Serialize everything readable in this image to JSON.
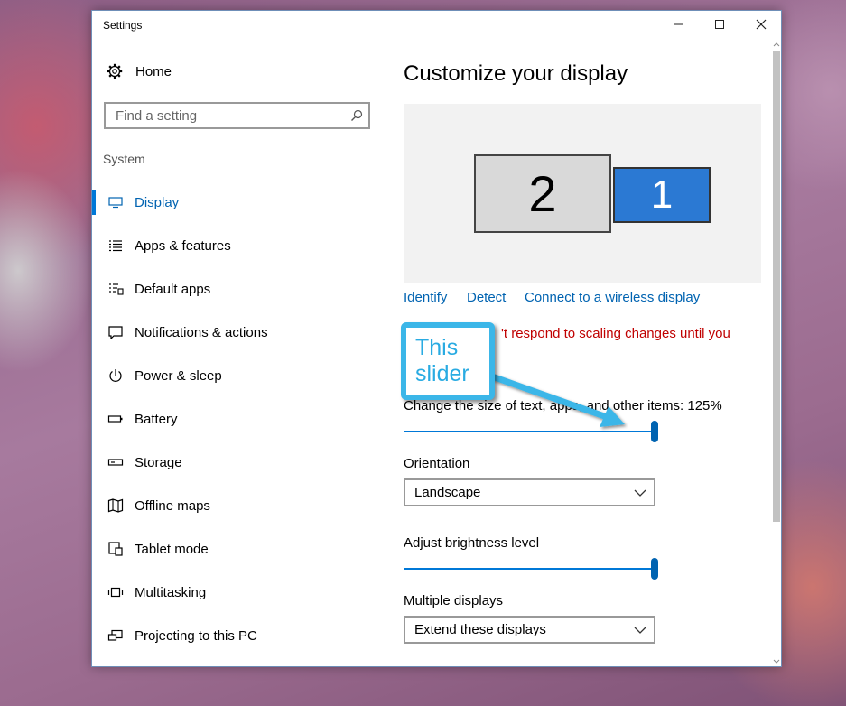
{
  "window": {
    "title": "Settings"
  },
  "sidebar": {
    "home_label": "Home",
    "search_placeholder": "Find a setting",
    "section_heading": "System",
    "items": [
      {
        "label": "Display",
        "icon": "monitor-icon",
        "active": true
      },
      {
        "label": "Apps & features",
        "icon": "list-icon"
      },
      {
        "label": "Default apps",
        "icon": "default-apps-icon"
      },
      {
        "label": "Notifications & actions",
        "icon": "notification-icon"
      },
      {
        "label": "Power & sleep",
        "icon": "power-icon"
      },
      {
        "label": "Battery",
        "icon": "battery-icon"
      },
      {
        "label": "Storage",
        "icon": "storage-icon"
      },
      {
        "label": "Offline maps",
        "icon": "map-icon"
      },
      {
        "label": "Tablet mode",
        "icon": "tablet-icon"
      },
      {
        "label": "Multitasking",
        "icon": "multitasking-icon"
      },
      {
        "label": "Projecting to this PC",
        "icon": "projector-icon"
      }
    ]
  },
  "main": {
    "title": "Customize your display",
    "monitors": {
      "secondary": "2",
      "primary": "1"
    },
    "links": {
      "identify": "Identify",
      "detect": "Detect",
      "wireless": "Connect to a wireless display"
    },
    "warning_visible": "'t respond to scaling changes until you",
    "scale_label": "Change the size of text, apps, and other items: 125%",
    "scale_slider_fraction": 1.0,
    "orientation": {
      "label": "Orientation",
      "value": "Landscape"
    },
    "brightness": {
      "label": "Adjust brightness level",
      "fraction": 1.0
    },
    "multiple_displays": {
      "label": "Multiple displays",
      "value": "Extend these displays"
    }
  },
  "annotation": {
    "line1": "This",
    "line2": "slider"
  },
  "colors": {
    "accent": "#0078d7",
    "link": "#0063b1",
    "warning": "#c00000",
    "callout": "#3bb6e8"
  }
}
